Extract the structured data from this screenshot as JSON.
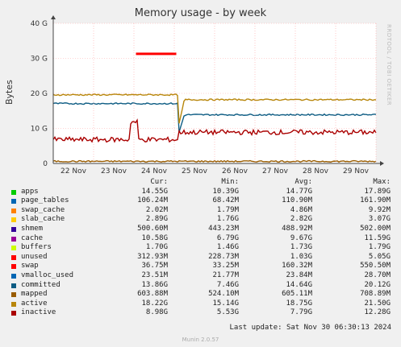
{
  "window": {
    "title": "Memory usage - by week"
  },
  "side_text": "RRDTOOL / TOBI OETIKER",
  "chart_data": {
    "type": "area",
    "title": "Memory usage - by week",
    "ylabel": "Bytes",
    "ylim": [
      0,
      40
    ],
    "y_unit": "G",
    "y_ticks": [
      "0",
      "10 G",
      "20 G",
      "30 G",
      "40 G"
    ],
    "y_tick_values": [
      0,
      10,
      20,
      30,
      40
    ],
    "categories": [
      "22 Nov",
      "23 Nov",
      "24 Nov",
      "25 Nov",
      "26 Nov",
      "27 Nov",
      "28 Nov",
      "29 Nov"
    ],
    "grid": true,
    "total_memory_G": 30.9,
    "swap_spike": {
      "start_day": 2.05,
      "end_day": 3.05,
      "value_G": 31.3
    },
    "step_day": 3.1,
    "series_stack": [
      {
        "name": "apps",
        "color": "#00cc00",
        "before_G": 15.2,
        "after_G": 13.6,
        "dip_G": 8.6
      },
      {
        "name": "page_tables",
        "color": "#0066b3",
        "before_G": 0.1,
        "after_G": 0.1
      },
      {
        "name": "swap_cache",
        "color": "#ff8000",
        "before_G": 0.0,
        "after_G": 0.0
      },
      {
        "name": "slab_cache",
        "color": "#ffcc00",
        "before_G": 2.9,
        "after_G": 2.9
      },
      {
        "name": "shmem",
        "color": "#330099",
        "before_G": 0.5,
        "after_G": 0.5
      },
      {
        "name": "cache",
        "color": "#990099",
        "before_G": 9.7,
        "after_G": 10.6
      },
      {
        "name": "buffers",
        "color": "#ccff00",
        "before_G": 1.7,
        "after_G": 1.7
      },
      {
        "name": "unused",
        "color": "#ff0000",
        "before_G": 0.3,
        "after_G": 1.5
      }
    ],
    "line_series": [
      {
        "name": "committed",
        "color": "#0d5c83",
        "before_G": 17.1,
        "after_G": 13.9,
        "dip_G": 8.2
      },
      {
        "name": "active",
        "color": "#b8860b",
        "before_G": 19.6,
        "after_G": 18.2,
        "dip_G": 10.2
      },
      {
        "name": "inactive",
        "color": "#aa0000",
        "before_G": 6.8,
        "after_G": 8.9,
        "spike_G": 11.8
      },
      {
        "name": "mapped",
        "color": "#995c00",
        "value_G": 0.6
      }
    ],
    "legend": {
      "columns": [
        "Cur:",
        "Min:",
        "Avg:",
        "Max:"
      ],
      "rows": [
        {
          "name": "apps",
          "color": "#00cc00",
          "cur": "14.55G",
          "min": "10.39G",
          "avg": "14.77G",
          "max": "17.89G"
        },
        {
          "name": "page_tables",
          "color": "#0066b3",
          "cur": "106.24M",
          "min": "68.42M",
          "avg": "110.90M",
          "max": "161.90M"
        },
        {
          "name": "swap_cache",
          "color": "#ff8000",
          "cur": "2.02M",
          "min": "1.79M",
          "avg": "4.86M",
          "max": "9.92M"
        },
        {
          "name": "slab_cache",
          "color": "#ffcc00",
          "cur": "2.89G",
          "min": "1.76G",
          "avg": "2.82G",
          "max": "3.07G"
        },
        {
          "name": "shmem",
          "color": "#330099",
          "cur": "500.60M",
          "min": "443.23M",
          "avg": "488.92M",
          "max": "502.00M"
        },
        {
          "name": "cache",
          "color": "#990099",
          "cur": "10.58G",
          "min": "6.79G",
          "avg": "9.67G",
          "max": "11.59G"
        },
        {
          "name": "buffers",
          "color": "#ccff00",
          "cur": "1.70G",
          "min": "1.46G",
          "avg": "1.73G",
          "max": "1.79G"
        },
        {
          "name": "unused",
          "color": "#ff0000",
          "cur": "312.93M",
          "min": "228.73M",
          "avg": "1.03G",
          "max": "5.05G"
        },
        {
          "name": "swap",
          "color": "#ff0000",
          "cur": "36.75M",
          "min": "33.25M",
          "avg": "160.32M",
          "max": "550.50M"
        },
        {
          "name": "vmalloc_used",
          "color": "#0066b3",
          "cur": "23.51M",
          "min": "21.77M",
          "avg": "23.84M",
          "max": "28.70M"
        },
        {
          "name": "committed",
          "color": "#0d5c83",
          "cur": "13.86G",
          "min": "7.46G",
          "avg": "14.64G",
          "max": "20.12G"
        },
        {
          "name": "mapped",
          "color": "#995c00",
          "cur": "603.88M",
          "min": "524.10M",
          "avg": "605.11M",
          "max": "708.89M"
        },
        {
          "name": "active",
          "color": "#b8860b",
          "cur": "18.22G",
          "min": "15.14G",
          "avg": "18.75G",
          "max": "21.50G"
        },
        {
          "name": "inactive",
          "color": "#aa0000",
          "cur": "8.98G",
          "min": "5.53G",
          "avg": "7.79G",
          "max": "12.28G"
        }
      ]
    }
  },
  "last_update": "Last update: Sat Nov 30 06:30:13 2024",
  "footer": "Munin 2.0.57"
}
